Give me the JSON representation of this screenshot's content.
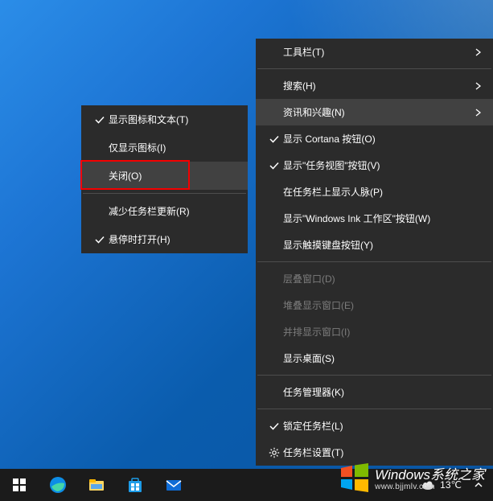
{
  "main_menu": {
    "toolbar": "工具栏(T)",
    "search": "搜索(H)",
    "news_interests": "资讯和兴趣(N)",
    "cortana": "显示 Cortana 按钮(O)",
    "task_view": "显示\"任务视图\"按钮(V)",
    "people": "在任务栏上显示人脉(P)",
    "windows_ink": "显示\"Windows Ink 工作区\"按钮(W)",
    "touch_keyboard": "显示触摸键盘按钮(Y)",
    "cascade": "层叠窗口(D)",
    "stacked": "堆叠显示窗口(E)",
    "side_by_side": "并排显示窗口(I)",
    "show_desktop": "显示桌面(S)",
    "task_manager": "任务管理器(K)",
    "lock_taskbar": "锁定任务栏(L)",
    "taskbar_settings": "任务栏设置(T)"
  },
  "submenu": {
    "show_icon_text": "显示图标和文本(T)",
    "show_icon_only": "仅显示图标(I)",
    "close": "关闭(O)",
    "reduce_updates": "减少任务栏更新(R)",
    "open_on_hover": "悬停时打开(H)"
  },
  "taskbar": {
    "weather_temp": "13℃"
  },
  "watermark": {
    "title": "Windows系统之家",
    "url": "www.bjjmlv.com"
  }
}
